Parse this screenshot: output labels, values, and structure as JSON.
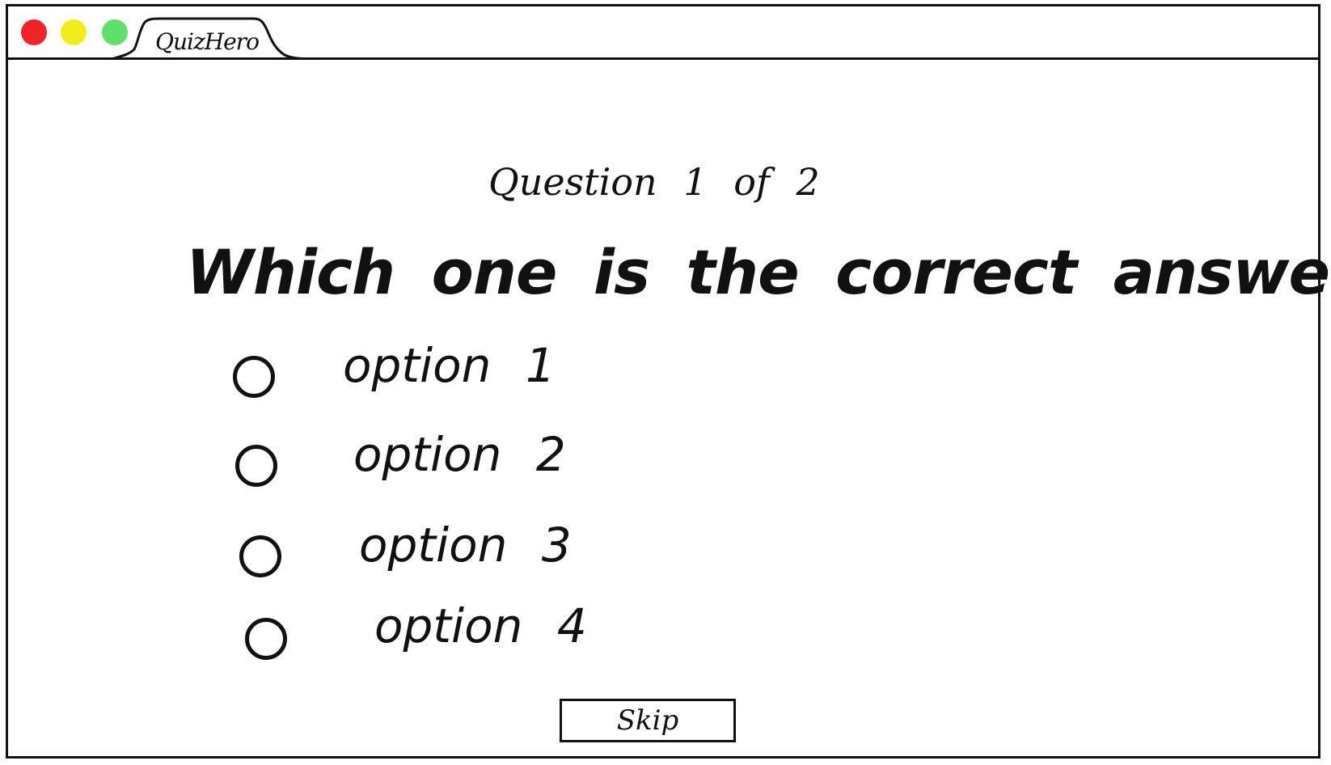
{
  "window": {
    "tab_title": "QuizHero",
    "controls": {
      "close_color": "#ee2427",
      "minimize_color": "#f3ec1b",
      "maximize_color": "#5fe06a"
    }
  },
  "quiz": {
    "progress": "Question 1 of 2",
    "question": "Which one is the correct answer?",
    "options": [
      {
        "label": "option 1"
      },
      {
        "label": "option 2"
      },
      {
        "label": "option 3"
      },
      {
        "label": "option 4"
      }
    ],
    "skip_label": "Skip"
  }
}
